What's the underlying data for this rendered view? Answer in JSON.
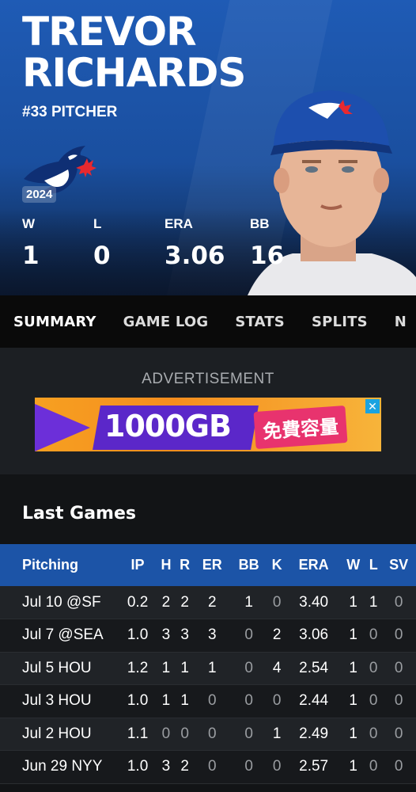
{
  "player": {
    "first_name": "TREVOR",
    "last_name": "RICHARDS",
    "number_position": "#33 PITCHER",
    "season": "2024",
    "team_logo": "blue-jays-logo"
  },
  "stats": [
    {
      "label": "W",
      "value": "1"
    },
    {
      "label": "L",
      "value": "0"
    },
    {
      "label": "ERA",
      "value": "3.06"
    },
    {
      "label": "BB",
      "value": "16"
    }
  ],
  "nav": {
    "tabs": [
      "SUMMARY",
      "GAME LOG",
      "STATS",
      "SPLITS",
      "N"
    ],
    "active": "SUMMARY"
  },
  "ad": {
    "label": "ADVERTISEMENT",
    "headline": "1000GB",
    "cta": "免費容量",
    "close": "✕"
  },
  "last_games": {
    "title": "Last Games",
    "columns": [
      "Pitching",
      "IP",
      "H",
      "R",
      "ER",
      "BB",
      "K",
      "ERA",
      "W",
      "L",
      "SV"
    ],
    "rows": [
      [
        "Jul 10 @SF",
        "0.2",
        "2",
        "2",
        "2",
        "1",
        "0",
        "3.40",
        "1",
        "1",
        "0"
      ],
      [
        "Jul 7 @SEA",
        "1.0",
        "3",
        "3",
        "3",
        "0",
        "2",
        "3.06",
        "1",
        "0",
        "0"
      ],
      [
        "Jul 5 HOU",
        "1.2",
        "1",
        "1",
        "1",
        "0",
        "4",
        "2.54",
        "1",
        "0",
        "0"
      ],
      [
        "Jul 3 HOU",
        "1.0",
        "1",
        "1",
        "0",
        "0",
        "0",
        "2.44",
        "1",
        "0",
        "0"
      ],
      [
        "Jul 2 HOU",
        "1.1",
        "0",
        "0",
        "0",
        "0",
        "1",
        "2.49",
        "1",
        "0",
        "0"
      ],
      [
        "Jun 29 NYY",
        "1.0",
        "3",
        "2",
        "0",
        "0",
        "0",
        "2.57",
        "1",
        "0",
        "0"
      ]
    ]
  },
  "colors": {
    "hero_blue": "#1f5bb5",
    "table_header": "#1c54a7",
    "nav_bg": "#0a0a0a",
    "page_bg": "#121416"
  }
}
